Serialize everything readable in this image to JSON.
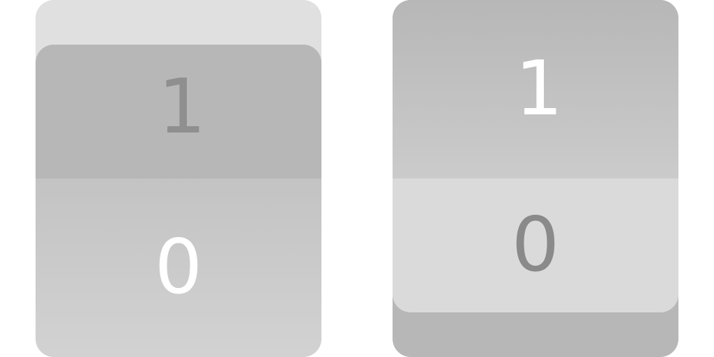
{
  "switches": [
    {
      "name": "left",
      "on_label": "1",
      "off_label": "0",
      "state": "0"
    },
    {
      "name": "right",
      "on_label": "1",
      "off_label": "0",
      "state": "1"
    }
  ],
  "colors": {
    "background": "#ffffff",
    "switch_light": "#e0e0e0",
    "switch_dark": "#b7b7b7",
    "label_active": "#ffffff",
    "label_inactive": "#8f8f8f"
  }
}
